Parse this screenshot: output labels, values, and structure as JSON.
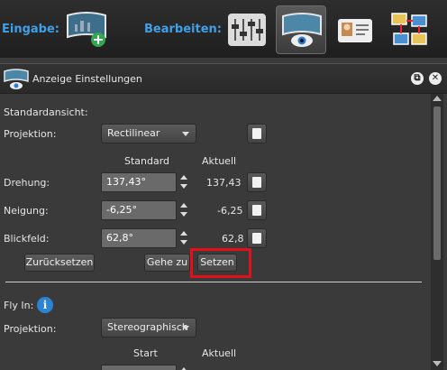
{
  "toolbar": {
    "input_label": "Eingabe:",
    "edit_label": "Bearbeiten:",
    "buttons": [
      {
        "icon": "add-image-icon"
      },
      {
        "icon": "sliders-icon"
      },
      {
        "icon": "panorama-view-icon"
      },
      {
        "icon": "id-card-icon"
      },
      {
        "icon": "layout-icon"
      }
    ]
  },
  "panel": {
    "title": "Anzeige Einstellungen",
    "restore_icon": "⧉",
    "close_icon": "✕"
  },
  "standard_view": {
    "section_label": "Standardansicht:",
    "projection_label": "Projektion:",
    "projection_value": "Rectilinear",
    "col_standard": "Standard",
    "col_current": "Aktuell",
    "rows": [
      {
        "label": "Drehung:",
        "value": "137,43°",
        "current": "137,43"
      },
      {
        "label": "Neigung:",
        "value": "-6,25°",
        "current": "-6,25"
      },
      {
        "label": "Blickfeld:",
        "value": "62,8°",
        "current": "62,8"
      }
    ],
    "reset_button": "Zurücksetzen",
    "goto_button": "Gehe zu",
    "set_button": "Setzen"
  },
  "fly_in": {
    "section_label": "Fly In:",
    "info_icon": "i",
    "projection_label": "Projektion:",
    "projection_value": "Stereographisch",
    "col_start": "Start",
    "col_current": "Aktuell"
  },
  "colors": {
    "accent": "#3fa0e8",
    "highlight": "#e3101a",
    "info": "#2b83d6"
  }
}
